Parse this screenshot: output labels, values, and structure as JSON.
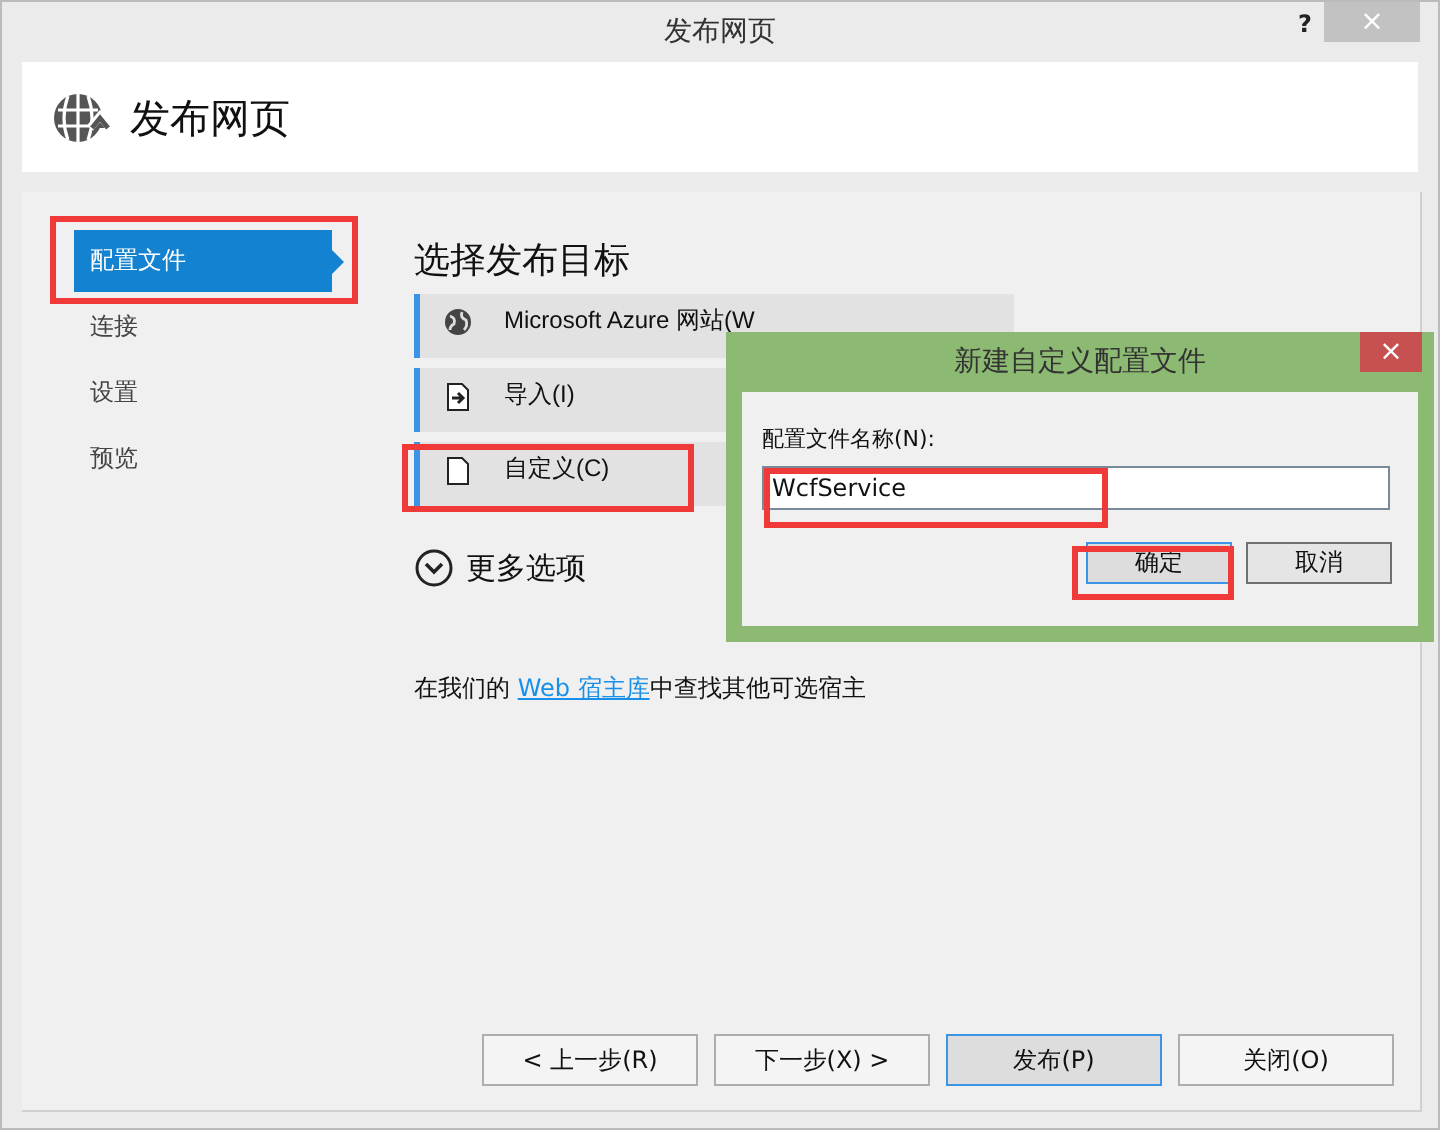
{
  "window": {
    "title": "发布网页",
    "help": "?",
    "close": "×"
  },
  "header": {
    "title": "发布网页"
  },
  "sidebar": {
    "items": [
      {
        "label": "配置文件",
        "selected": true
      },
      {
        "label": "连接",
        "selected": false
      },
      {
        "label": "设置",
        "selected": false
      },
      {
        "label": "预览",
        "selected": false
      }
    ]
  },
  "main": {
    "heading": "选择发布目标",
    "targets": [
      {
        "kind": "azure",
        "label": "Microsoft Azure 网站(W"
      },
      {
        "kind": "import",
        "label": "导入(I)"
      },
      {
        "kind": "custom",
        "label": "自定义(C)"
      }
    ],
    "more_options": "更多选项",
    "footer_text": {
      "before": "在我们的 ",
      "link": "Web 宿主库",
      "after": "中查找其他可选宿主"
    }
  },
  "dialog": {
    "title": "新建自定义配置文件",
    "close": "×",
    "field_label": "配置文件名称(N):",
    "value": "WcfService",
    "buttons": [
      {
        "label": "确定",
        "selected": true
      },
      {
        "label": "取消",
        "selected": false
      }
    ]
  },
  "buttons": [
    {
      "label": "< 上一步(R)",
      "selected": false
    },
    {
      "label": "下一步(X) >",
      "selected": false
    },
    {
      "label": "发布(P)",
      "selected": true
    },
    {
      "label": "关闭(O)",
      "selected": false
    }
  ]
}
